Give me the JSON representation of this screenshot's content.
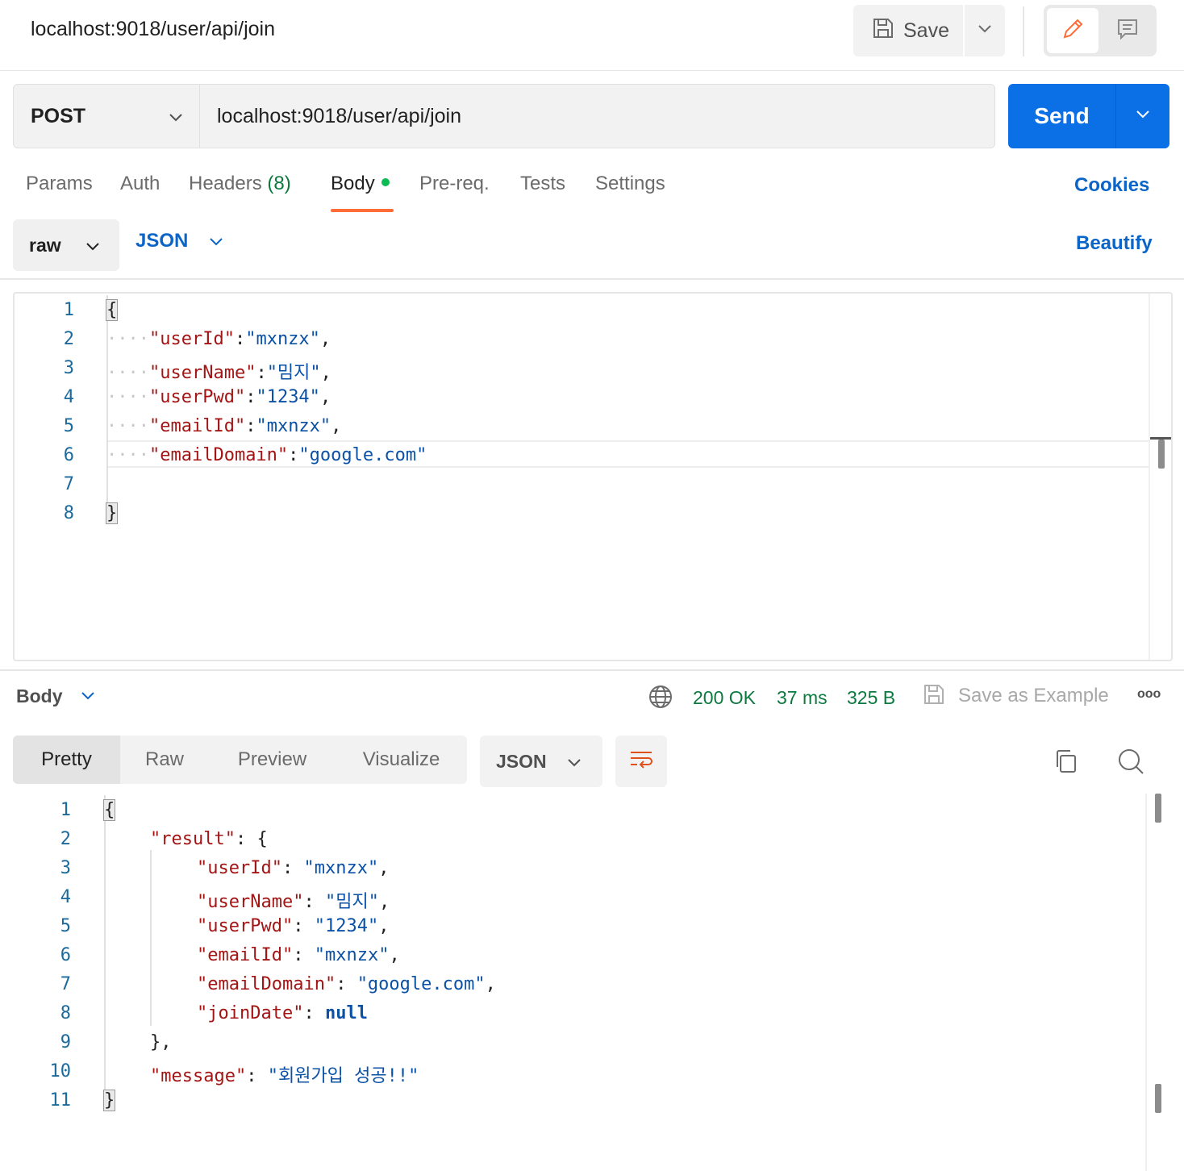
{
  "header": {
    "title": "localhost:9018/user/api/join",
    "save_label": "Save"
  },
  "request": {
    "method": "POST",
    "url": "localhost:9018/user/api/join",
    "send_label": "Send"
  },
  "tabs": {
    "params": "Params",
    "auth": "Auth",
    "headers": "Headers",
    "headers_count": "(8)",
    "body": "Body",
    "prereq": "Pre-req.",
    "tests": "Tests",
    "settings": "Settings",
    "cookies": "Cookies"
  },
  "body_options": {
    "mode": "raw",
    "language": "JSON",
    "beautify": "Beautify"
  },
  "request_body": {
    "line_numbers": [
      "1",
      "2",
      "3",
      "4",
      "5",
      "6",
      "7",
      "8"
    ],
    "open": "{",
    "close": "}",
    "dots": "····",
    "fields": [
      {
        "key": "\"userId\"",
        "value": "\"mxnzx\"",
        "sep": ",",
        "colon": ":"
      },
      {
        "key": "\"userName\"",
        "value": "\"밈지\"",
        "sep": ",",
        "colon": ":"
      },
      {
        "key": "\"userPwd\"",
        "value": "\"1234\"",
        "sep": ",",
        "colon": ":"
      },
      {
        "key": "\"emailId\"",
        "value": "\"mxnzx\"",
        "sep": ",",
        "colon": ":"
      },
      {
        "key": "\"emailDomain\"",
        "value": "\"google.com\"",
        "sep": "",
        "colon": ":"
      }
    ]
  },
  "response": {
    "body_label": "Body",
    "status": "200 OK",
    "time": "37 ms",
    "size": "325 B",
    "save_example": "Save as Example",
    "more": "ooo",
    "views": {
      "pretty": "Pretty",
      "raw": "Raw",
      "preview": "Preview",
      "visualize": "Visualize"
    },
    "format": "JSON"
  },
  "response_body": {
    "line_numbers": [
      "1",
      "2",
      "3",
      "4",
      "5",
      "6",
      "7",
      "8",
      "9",
      "10",
      "11"
    ],
    "open": "{",
    "close": "}",
    "result_key": "\"result\"",
    "result_open": ": {",
    "result_close": "},",
    "colon": ": ",
    "comma": ",",
    "fields": [
      {
        "key": "\"userId\"",
        "value": "\"mxnzx\""
      },
      {
        "key": "\"userName\"",
        "value": "\"밈지\""
      },
      {
        "key": "\"userPwd\"",
        "value": "\"1234\""
      },
      {
        "key": "\"emailId\"",
        "value": "\"mxnzx\""
      },
      {
        "key": "\"emailDomain\"",
        "value": "\"google.com\""
      }
    ],
    "join_key": "\"joinDate\"",
    "join_value": "null",
    "message_key": "\"message\"",
    "message_value": "\"회원가입 성공!!\""
  },
  "colors": {
    "accent": "#0b70e6",
    "active_tab": "#ff6c37",
    "status_ok": "#0c7a3e",
    "json_key": "#a31515",
    "json_string": "#0b51a6"
  }
}
